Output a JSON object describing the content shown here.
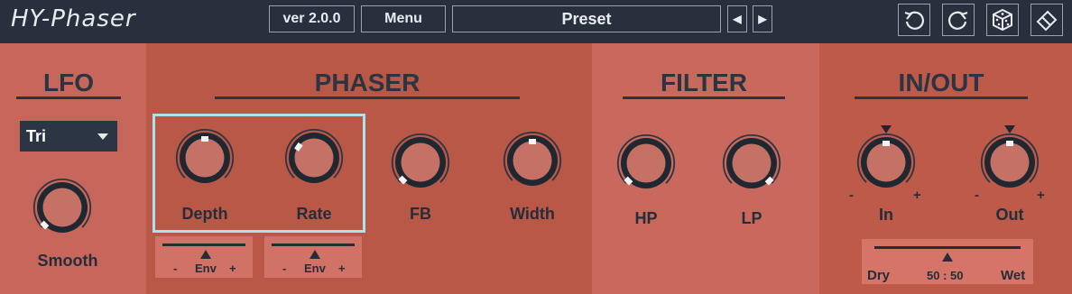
{
  "app": {
    "title": "HY-Phaser"
  },
  "toolbar": {
    "version_label": "ver 2.0.0",
    "menu_label": "Menu",
    "preset_label": "Preset",
    "prev_arrow": "◀",
    "next_arrow": "▶",
    "icons": [
      "undo-icon",
      "redo-icon",
      "dice-icon",
      "eraser-icon"
    ]
  },
  "sections": {
    "lfo": "LFO",
    "phaser": "PHASER",
    "filter": "FILTER",
    "inout": "IN/OUT"
  },
  "lfo": {
    "shape_selected": "Tri",
    "smooth_label": "Smooth"
  },
  "phaser": {
    "depth_label": "Depth",
    "rate_label": "Rate",
    "fb_label": "FB",
    "width_label": "Width",
    "env_label": "Env",
    "env_minus": "-",
    "env_plus": "+"
  },
  "filter": {
    "hp_label": "HP",
    "lp_label": "LP"
  },
  "inout": {
    "in_label": "In",
    "out_label": "Out",
    "minus": "-",
    "plus": "+",
    "dry_label": "Dry",
    "wet_label": "Wet",
    "mix_value": "50 : 50"
  },
  "colors": {
    "topbar": "#27303c",
    "panel_lfo": "#c7665a",
    "panel_phaser": "#b95847",
    "panel_filter": "#c9695d",
    "panel_inout": "#bd5a4a",
    "highlight": "#a9e3ee"
  }
}
